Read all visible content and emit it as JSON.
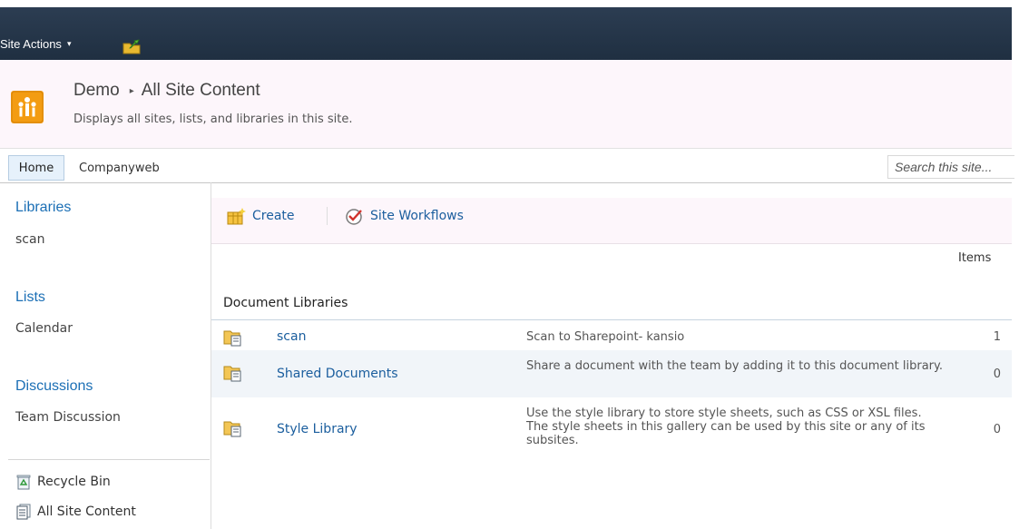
{
  "ribbon": {
    "site_actions_label": "Site Actions",
    "site_actions_caret": "▾"
  },
  "header": {
    "site_name": "Demo",
    "separator": "▸",
    "page_title": "All Site Content",
    "description": "Displays all sites, lists, and libraries in this site."
  },
  "topnav": {
    "tabs": [
      {
        "label": "Home",
        "selected": true
      },
      {
        "label": "Companyweb",
        "selected": false
      }
    ],
    "search_placeholder": "Search this site..."
  },
  "leftnav": {
    "sections": [
      {
        "heading": "Libraries",
        "items": [
          "scan"
        ]
      },
      {
        "heading": "Lists",
        "items": [
          "Calendar"
        ]
      },
      {
        "heading": "Discussions",
        "items": [
          "Team Discussion"
        ]
      }
    ],
    "utilities": [
      {
        "label": "Recycle Bin",
        "icon": "recycle-bin-icon"
      },
      {
        "label": "All Site Content",
        "icon": "all-site-content-icon"
      }
    ]
  },
  "toolbar": {
    "create_label": "Create",
    "workflows_label": "Site Workflows"
  },
  "content": {
    "items_header": "Items",
    "section_title": "Document Libraries",
    "rows": [
      {
        "name": "scan",
        "description": "Scan to Sharepoint- kansio",
        "count": "1"
      },
      {
        "name": "Shared Documents",
        "description": "Share a document with the team by adding it to this document library.",
        "count": "0"
      },
      {
        "name": "Style Library",
        "description": "Use the style library to store style sheets, such as CSS or XSL files. The style sheets in this gallery can be used by this site or any of its subsites.",
        "count": "0"
      }
    ]
  },
  "colors": {
    "ribbon": "#2c3d52",
    "link": "#1b5e9e",
    "nav_heading": "#1b6fb5",
    "title_bg": "#fdf6fb",
    "logo": "#f39c12"
  }
}
